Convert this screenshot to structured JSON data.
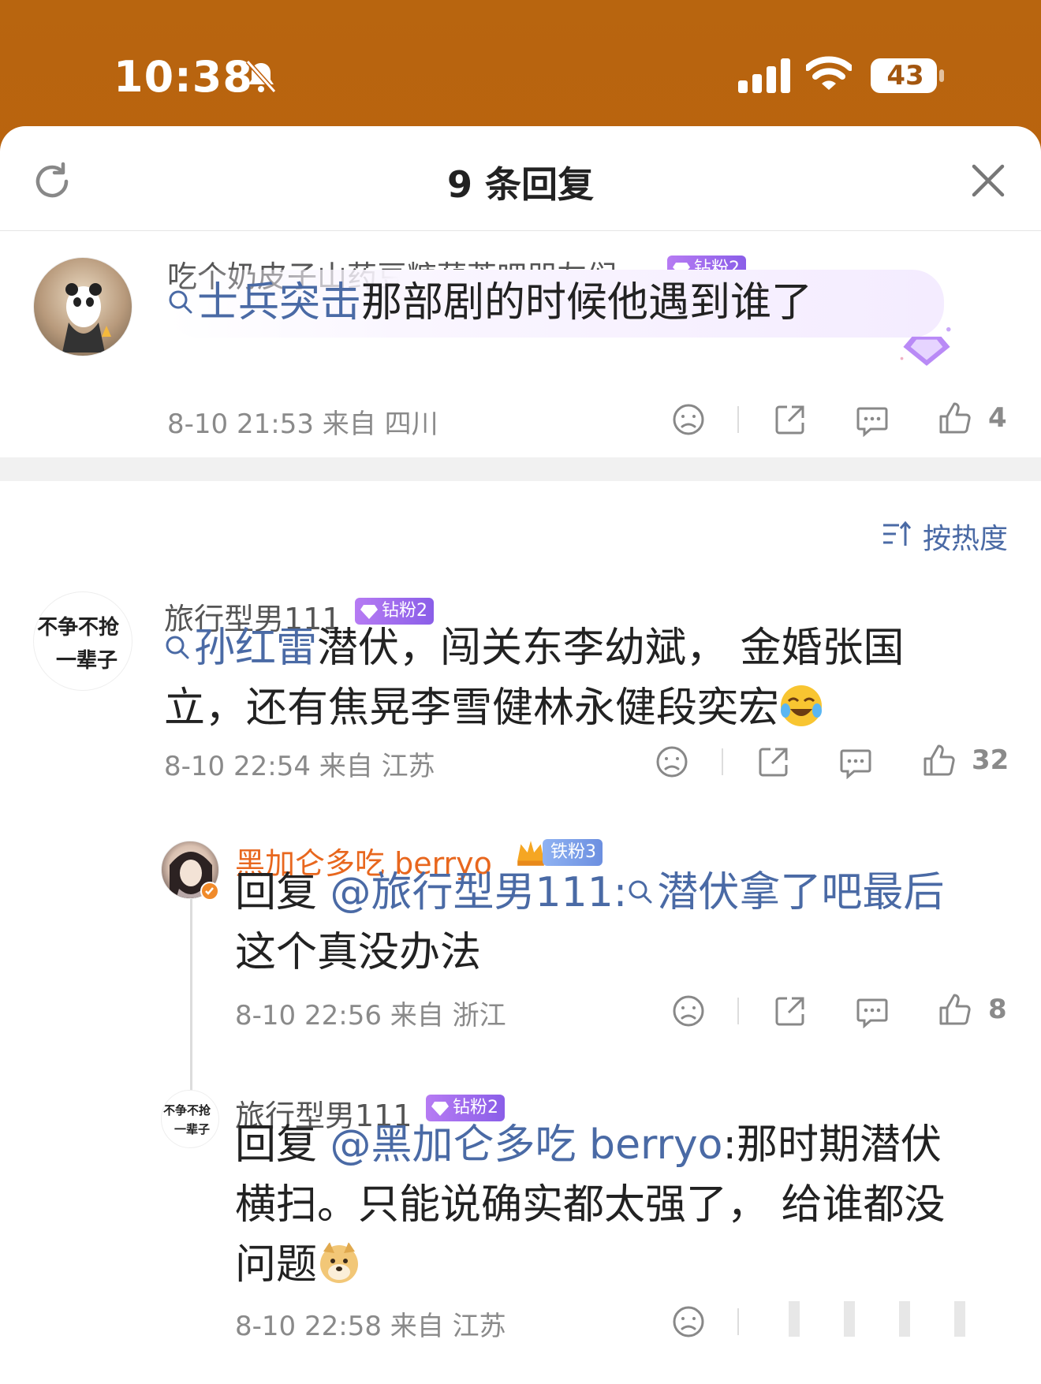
{
  "status_bar": {
    "time": "10:38",
    "battery": "43"
  },
  "header": {
    "title": "9 条回复"
  },
  "root_comment": {
    "username": "吃个奶皮子山药豆糖葫芦吧朋友们",
    "badge": "钻粉2",
    "topic_link": "士兵突击",
    "text": "那部剧的时候他遇到谁了",
    "meta": "8-10 21:53 来自 四川",
    "likes": "4"
  },
  "sort": {
    "label": "按热度"
  },
  "comments": [
    {
      "username": "旅行型男111",
      "badge": "钻粉2",
      "avatar_text_1": "不争不抢",
      "avatar_text_2": "一辈子",
      "topic_link": "孙红雷",
      "text_line1": "潜伏，闯关东李幼斌， 金婚张国",
      "text_line2": "立，还有焦晃李雪健林永健段奕宏",
      "meta": "8-10 22:54 来自 江苏",
      "likes": "32"
    },
    {
      "username": "黑加仑多吃 berryo",
      "badge": "铁粉3",
      "reply_prefix": "回复 ",
      "mention": "@旅行型男111:",
      "topic_link": "潜伏拿了吧最后",
      "text_line2": "这个真没办法",
      "meta": "8-10 22:56 来自 浙江",
      "likes": "8"
    },
    {
      "username": "旅行型男111",
      "badge": "钻粉2",
      "avatar_text_1": "不争不抢",
      "avatar_text_2": "一辈子",
      "reply_prefix": "回复 ",
      "mention": "@黑加仑多吃 berryo",
      "text_line1": ":那时期潜伏",
      "text_line2": "横扫。只能说确实都太强了， 给谁都没",
      "text_line3": "问题",
      "meta": "8-10 22:58 来自 江苏"
    }
  ]
}
